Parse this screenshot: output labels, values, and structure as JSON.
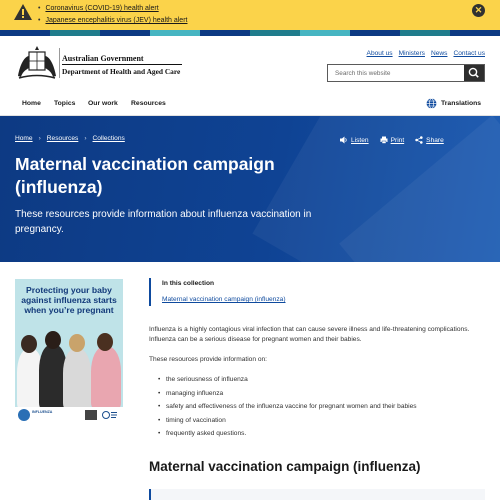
{
  "alerts": {
    "items": [
      {
        "label": "Coronavirus (COVID-19) health alert"
      },
      {
        "label": "Japanese encephalitis virus (JEV) health alert"
      }
    ],
    "close_symbol": "✕"
  },
  "stripe_colors": [
    "#0d3a83",
    "#1f7c8c",
    "#0d3a83",
    "#46b5c2",
    "#0d3a83",
    "#1f7c8c",
    "#46b5c2",
    "#0d3a83",
    "#1f7c8c",
    "#0d3a83"
  ],
  "header": {
    "gov_name": "Australian Government",
    "dept_name": "Department of Health and Aged Care",
    "utility_links": [
      "About us",
      "Ministers",
      "News",
      "Contact us"
    ],
    "search_placeholder": "Search this website"
  },
  "nav": {
    "items": [
      "Home",
      "Topics",
      "Our work",
      "Resources"
    ],
    "translations": "Translations"
  },
  "hero": {
    "breadcrumb": [
      "Home",
      "Resources",
      "Collections"
    ],
    "breadcrumb_separator": "›",
    "tools": [
      "Listen",
      "Print",
      "Share"
    ],
    "title": "Maternal vaccination campaign (influenza)",
    "description": "These resources provide information about influenza vaccination in pregnancy."
  },
  "poster": {
    "title": "Protecting your baby against influenza starts when you’re pregnant",
    "footer_text": "INFLUENZA",
    "colors": {
      "background": "#bfe3e8",
      "title": "#133a7a"
    }
  },
  "collection": {
    "title": "In this collection",
    "link": "Maternal vaccination campaign (influenza)"
  },
  "content": {
    "para1": "Influenza is a highly contagious viral infection that can cause severe illness and life-threatening complications. Influenza can be a serious disease for pregnant women and their babies.",
    "para2": "These resources provide information on:",
    "bullets": [
      "the seriousness of influenza",
      "managing influenza",
      "safety and effectiveness of the influenza vaccine for pregnant women and their babies",
      "timing of vaccination",
      "frequently asked questions."
    ],
    "heading": "Maternal vaccination campaign (influenza)"
  },
  "colors": {
    "alert": "#fbd34a",
    "brand": "#0d3a83",
    "link": "#0e4a9e"
  },
  "icons": [
    "warning-icon",
    "close-icon",
    "crest-icon",
    "search-icon",
    "globe-icon",
    "speaker-icon",
    "print-icon",
    "share-icon"
  ]
}
